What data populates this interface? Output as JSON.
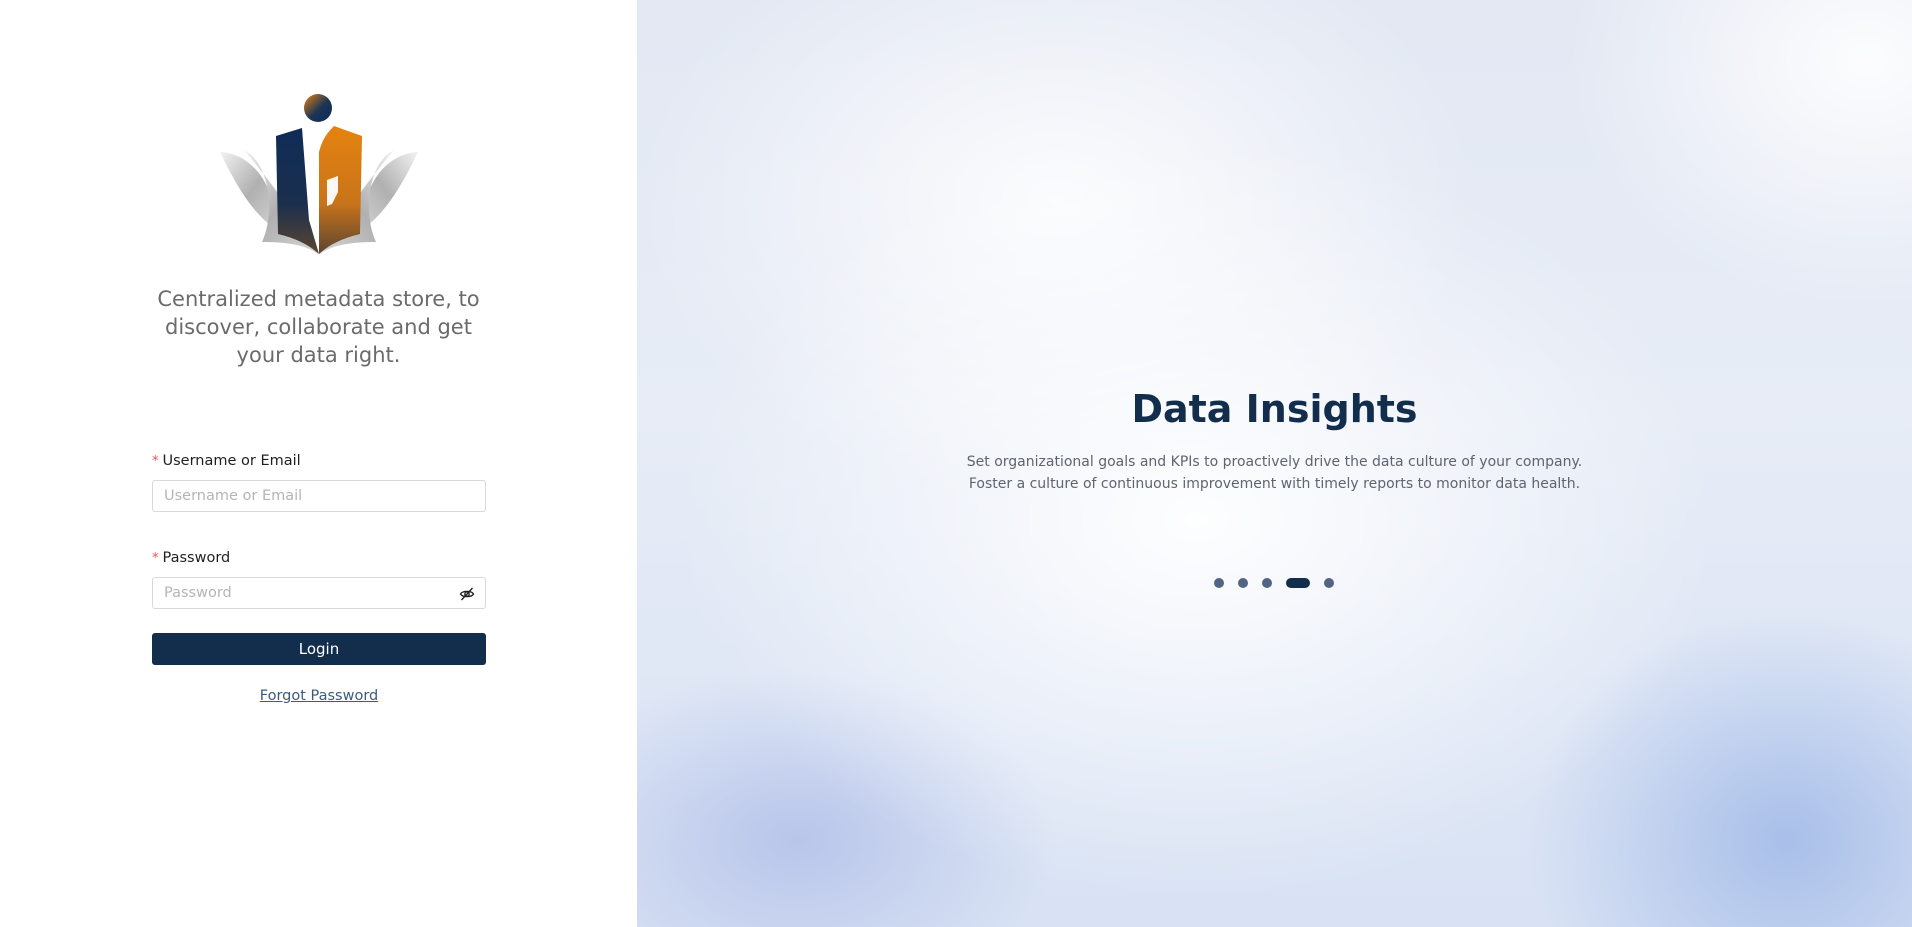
{
  "branding": {
    "tagline": "Centralized metadata store, to discover, collaborate and get your data right.",
    "logo_icon": "openmetadata-logo-icon",
    "colors": {
      "navy": "#132d4d",
      "orange": "#e07f10",
      "required": "#ff4d4f"
    }
  },
  "login_form": {
    "username": {
      "label": "Username or Email",
      "required_marker": "*",
      "placeholder": "Username or Email",
      "value": ""
    },
    "password": {
      "label": "Password",
      "required_marker": "*",
      "placeholder": "Password",
      "value": "",
      "toggle_icon": "eye-slash-icon"
    },
    "login_label": "Login",
    "forgot_password_label": "Forgot Password"
  },
  "carousel": {
    "title": "Data Insights",
    "description_line1": "Set organizational goals and KPIs to proactively drive the data culture of your company.",
    "description_line2": "Foster a culture of continuous improvement with timely reports to monitor data health.",
    "slide_count": 5,
    "active_index": 3
  }
}
